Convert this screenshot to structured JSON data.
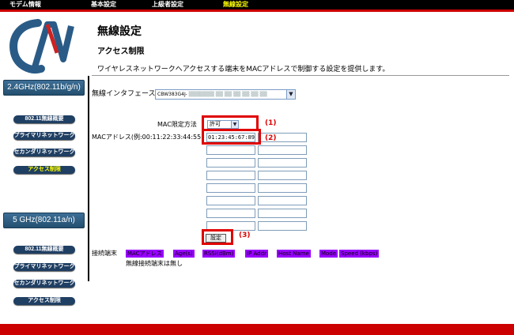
{
  "top_nav": [
    "モデム情報",
    "基本設定",
    "上級者設定",
    "無線設定"
  ],
  "sidebar": {
    "band_24": {
      "title": "2.4GHz(802.11b/g/n)",
      "links": [
        "802.11無線概要",
        "プライマリネットワーク",
        "セカンダリネットワーク",
        "アクセス制限"
      ]
    },
    "band_5": {
      "title": "5 GHz(802.11a/n)",
      "links": [
        "802.11無線概要",
        "プライマリネットワーク",
        "セカンダリネットワーク",
        "アクセス制限"
      ]
    }
  },
  "main": {
    "title": "無線設定",
    "section": "アクセス制限",
    "description": "ワイヤレスネットワークへアクセスする端末をMACアドレスで制御する設定を提供します。",
    "interface_label": "無線インタフェース",
    "interface_value": "CBW383G4J-",
    "mac_mode_label": "MAC限定方法",
    "mac_mode_value": "許可",
    "mac_address_label": "MACアドレス(例:00:11:22:33:44:55)",
    "mac_first_value": "01:23:45:67:89:01",
    "set_button": "設定",
    "connected_label": "接続端末",
    "columns": [
      "MACアドレス",
      "Age(s)",
      "RSSI(dBm)",
      "IP Addr",
      "Host Name",
      "Mode",
      "Speed (kbps)"
    ],
    "no_clients": "無線接続端末は無し",
    "annotations": [
      "(1)",
      "(2)",
      "(3)"
    ]
  },
  "colors": {
    "accent_red": "#cc0000",
    "header_purple": "#9900ff",
    "nav_active": "#ffff00"
  }
}
